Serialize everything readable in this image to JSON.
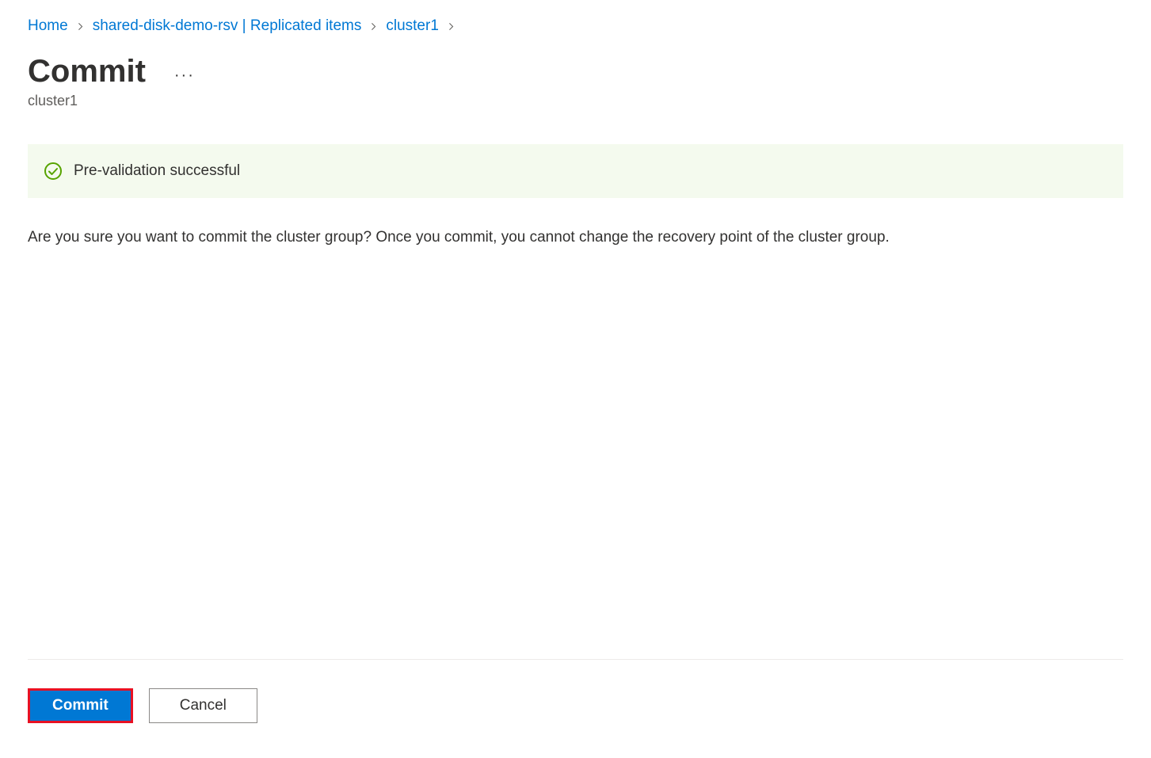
{
  "breadcrumb": {
    "home": "Home",
    "level1": "shared-disk-demo-rsv | Replicated items",
    "level2": "cluster1"
  },
  "page": {
    "title": "Commit",
    "subtitle": "cluster1"
  },
  "status": {
    "message": "Pre-validation successful"
  },
  "body": {
    "confirmation": "Are you sure you want to commit the cluster group? Once you commit, you cannot change the recovery point of the cluster group."
  },
  "buttons": {
    "commit": "Commit",
    "cancel": "Cancel"
  }
}
